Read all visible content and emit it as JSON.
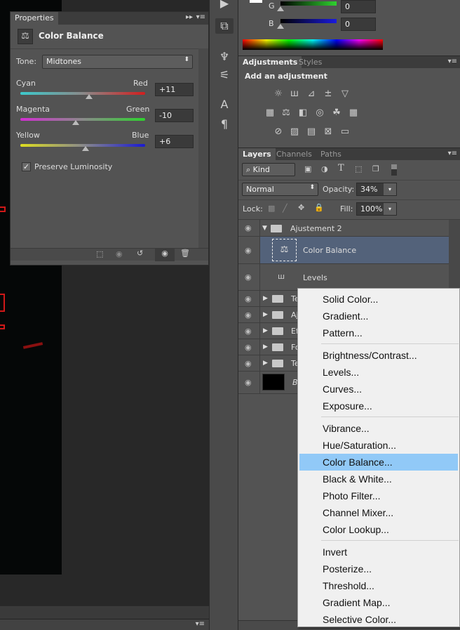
{
  "properties": {
    "tab": "Properties",
    "title": "Color Balance",
    "tone_label": "Tone:",
    "tone_value": "Midtones",
    "sliders": [
      {
        "left": "Cyan",
        "right": "Red",
        "value": "+11",
        "level": 11
      },
      {
        "left": "Magenta",
        "right": "Green",
        "value": "-10",
        "level": -10
      },
      {
        "left": "Yellow",
        "right": "Blue",
        "value": "+6",
        "level": 6
      }
    ],
    "preserve_luminosity": "Preserve Luminosity",
    "preserve_checked": true
  },
  "color": {
    "g_label": "G",
    "g_value": "0",
    "b_label": "B",
    "b_value": "0"
  },
  "adjustments": {
    "tabs": [
      "Adjustments",
      "Styles"
    ],
    "heading": "Add an adjustment"
  },
  "layers": {
    "tabs": [
      "Layers",
      "Channels",
      "Paths"
    ],
    "kind": "Kind",
    "blend_mode": "Normal",
    "opacity_label": "Opacity:",
    "opacity": "34%",
    "lock_label": "Lock:",
    "fill_label": "Fill:",
    "fill": "100%",
    "rows": [
      {
        "name": "Ajustement 2"
      },
      {
        "name": "Color Balance"
      },
      {
        "name": "Levels"
      },
      {
        "name": "Te"
      },
      {
        "name": "Aj"
      },
      {
        "name": "Ef"
      },
      {
        "name": "Fo"
      },
      {
        "name": "Te"
      },
      {
        "name": "B"
      }
    ]
  },
  "menu": {
    "groups": [
      [
        "Solid Color...",
        "Gradient...",
        "Pattern..."
      ],
      [
        "Brightness/Contrast...",
        "Levels...",
        "Curves...",
        "Exposure..."
      ],
      [
        "Vibrance...",
        "Hue/Saturation...",
        "Color Balance...",
        "Black & White...",
        "Photo Filter...",
        "Channel Mixer...",
        "Color Lookup..."
      ],
      [
        "Invert",
        "Posterize...",
        "Threshold...",
        "Gradient Map...",
        "Selective Color..."
      ]
    ],
    "highlighted": "Color Balance...",
    "highlight_color": "#91c9f7"
  }
}
